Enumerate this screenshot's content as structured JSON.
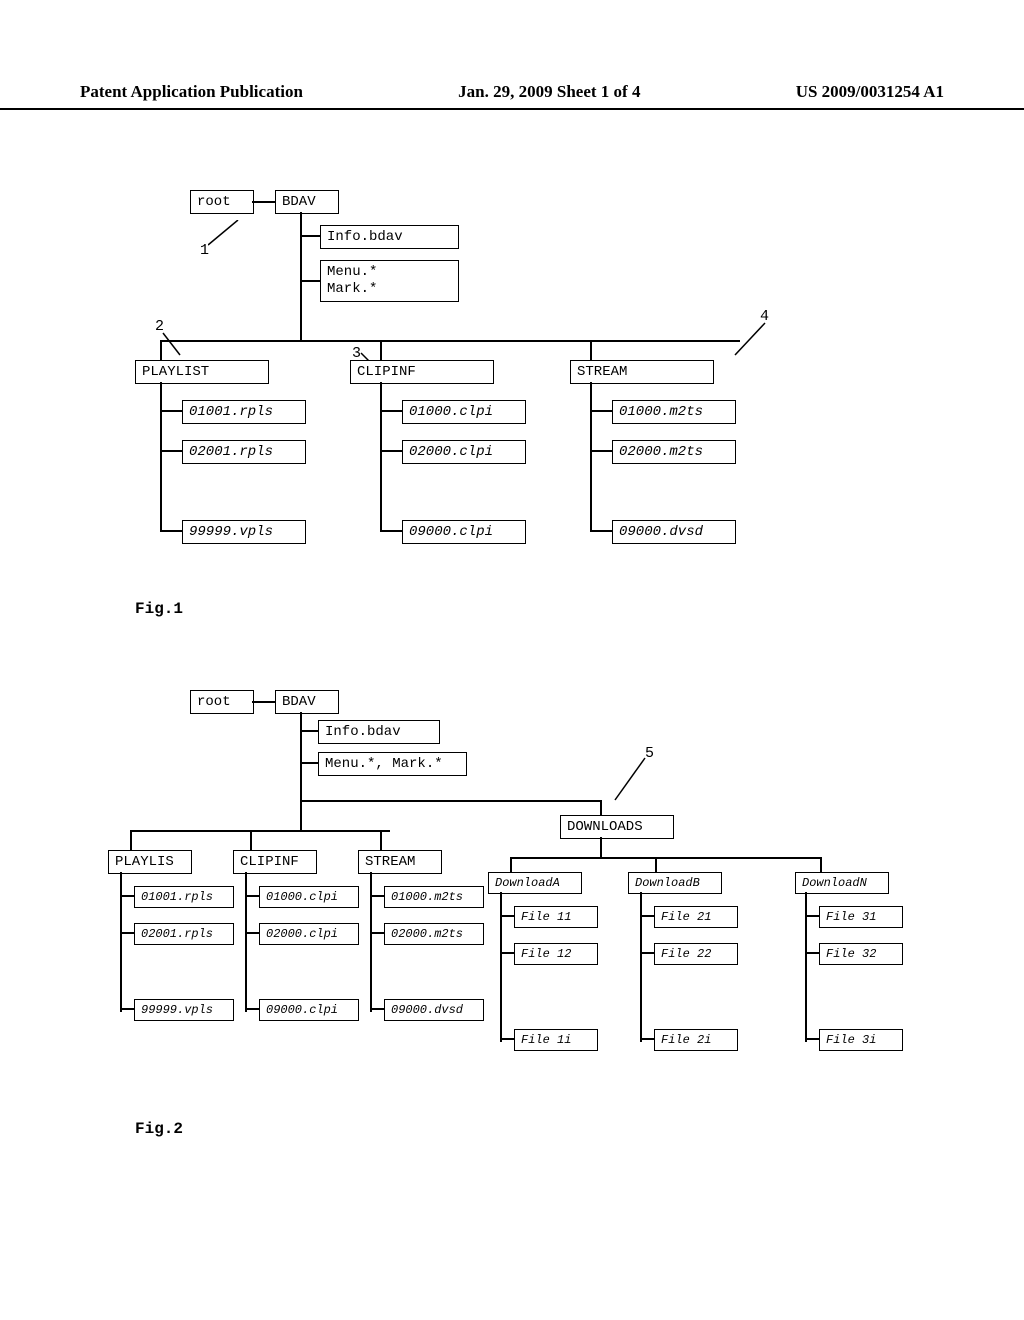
{
  "header": {
    "left": "Patent Application Publication",
    "center": "Jan. 29, 2009  Sheet 1 of 4",
    "right": "US 2009/0031254 A1"
  },
  "fig1": {
    "label": "Fig.1",
    "root": "root",
    "bdav": "BDAV",
    "info": "Info.bdav",
    "menumark": "Menu.*\nMark.*",
    "playlist": "PLAYLIST",
    "clipinf": "CLIPINF",
    "stream": "STREAM",
    "p1": "01001.rpls",
    "p2": "02001.rpls",
    "p3": "99999.vpls",
    "c1": "01000.clpi",
    "c2": "02000.clpi",
    "c3": "09000.clpi",
    "s1": "01000.m2ts",
    "s2": "02000.m2ts",
    "s3": "09000.dvsd",
    "n1": "1",
    "n2": "2",
    "n3": "3",
    "n4": "4"
  },
  "fig2": {
    "label": "Fig.2",
    "root": "root",
    "bdav": "BDAV",
    "info": "Info.bdav",
    "menumark": "Menu.*, Mark.*",
    "playlis": "PLAYLIS",
    "clipinf": "CLIPINF",
    "stream": "STREAM",
    "downloads": "DOWNLOADS",
    "p1": "01001.rpls",
    "p2": "02001.rpls",
    "p3": "99999.vpls",
    "c1": "01000.clpi",
    "c2": "02000.clpi",
    "c3": "09000.clpi",
    "s1": "01000.m2ts",
    "s2": "02000.m2ts",
    "s3": "09000.dvsd",
    "da": "DownloadA",
    "db": "DownloadB",
    "dn": "DownloadN",
    "f11": "File 11",
    "f12": "File 12",
    "f1i": "File 1i",
    "f21": "File 21",
    "f22": "File 22",
    "f2i": "File 2i",
    "f31": "File 31",
    "f32": "File 32",
    "f3i": "File 3i",
    "n5": "5"
  }
}
